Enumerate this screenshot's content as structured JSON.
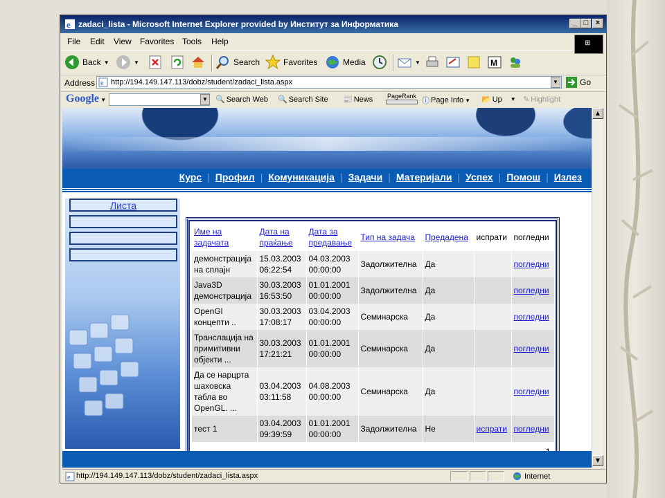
{
  "window": {
    "title": "zadaci_lista - Microsoft Internet Explorer provided by Институт за Информатика"
  },
  "menu": [
    "File",
    "Edit",
    "View",
    "Favorites",
    "Tools",
    "Help"
  ],
  "toolbar": {
    "back": "Back",
    "search": "Search",
    "favorites": "Favorites",
    "media": "Media"
  },
  "address": {
    "label": "Address",
    "url": "http://194.149.147.113/dobz/student/zadaci_lista.aspx",
    "go": "Go"
  },
  "google": {
    "logo": "Google",
    "search_web": "Search Web",
    "search_site": "Search Site",
    "news": "News",
    "pagerank": "PageRank",
    "page_info": "Page Info",
    "up": "Up",
    "highlight": "Highlight"
  },
  "nav": [
    "Курс",
    "Профил",
    "Комуникација",
    "Задачи",
    "Материјали",
    "Успех",
    "Помош",
    "Излез"
  ],
  "sidebar": {
    "items": [
      "Листа",
      "",
      "",
      ""
    ]
  },
  "table": {
    "headers": [
      {
        "text": "Име на задачата",
        "link": true
      },
      {
        "text": "Дата на праќање",
        "link": true
      },
      {
        "text": "Дата за предавање",
        "link": true
      },
      {
        "text": "Тип на задача",
        "link": true
      },
      {
        "text": "Предадена",
        "link": true
      },
      {
        "text": "испрати",
        "link": false
      },
      {
        "text": "погледни",
        "link": false
      }
    ],
    "rows": [
      {
        "name": "демонстрација на сплајн",
        "sent": "15.03.2003 06:22:54",
        "due": "04.03.2003 00:00:00",
        "type": "Задолжителна",
        "submitted": "Да",
        "send": "",
        "view": "погледни"
      },
      {
        "name": "Java3D демонстрација",
        "sent": "30.03.2003 16:53:50",
        "due": "01.01.2001 00:00:00",
        "type": "Задолжителна",
        "submitted": "Да",
        "send": "",
        "view": "погледни"
      },
      {
        "name": "OpenGl концепти ..",
        "sent": "30.03.2003 17:08:17",
        "due": "03.04.2003 00:00:00",
        "type": "Семинарска",
        "submitted": "Да",
        "send": "",
        "view": "погледни"
      },
      {
        "name": "Транслација на примитивни објекти ...",
        "sent": "30.03.2003 17:21:21",
        "due": "01.01.2001 00:00:00",
        "type": "Семинарска",
        "submitted": "Да",
        "send": "",
        "view": "погледни"
      },
      {
        "name": "Да се нарцрта шаховска табла во OpenGL. ...",
        "sent": "03.04.2003 03:11:58",
        "due": "04.08.2003 00:00:00",
        "type": "Семинарска",
        "submitted": "Да",
        "send": "",
        "view": "погледни"
      },
      {
        "name": "тест 1",
        "sent": "03.04.2003 09:39:59",
        "due": "01.01.2001 00:00:00",
        "type": "Задолжителна",
        "submitted": "Не",
        "send": "испрати",
        "view": "погледни"
      }
    ],
    "pager": "1"
  },
  "status": {
    "url": "http://194.149.147.113/dobz/student/zadaci_lista.aspx",
    "zone": "Internet"
  },
  "colors": {
    "title_bar": "#0a246a",
    "nav_bg": "#0a5bb3",
    "link": "#2020d0",
    "table_border": "#1a2a7a"
  }
}
